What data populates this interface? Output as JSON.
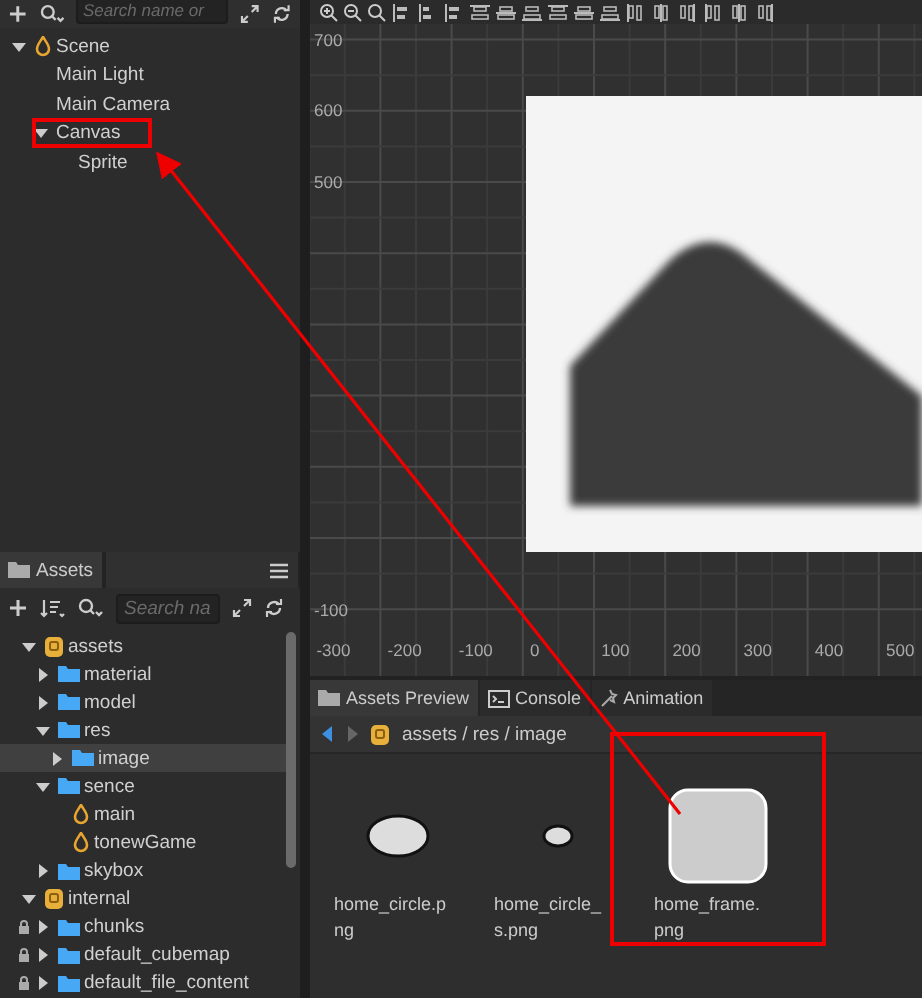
{
  "hierarchy": {
    "search": {
      "placeholder": "Search name or"
    },
    "tree": [
      {
        "label": "Scene",
        "kind": "scene",
        "expanded": true,
        "children": [
          {
            "label": "Main Light"
          },
          {
            "label": "Main Camera"
          },
          {
            "label": "Canvas",
            "expanded": true,
            "children": [
              {
                "label": "Sprite"
              }
            ]
          }
        ]
      }
    ]
  },
  "assets": {
    "tab": {
      "label": "Assets",
      "selected": true
    },
    "search": {
      "placeholder": "Search na"
    },
    "tree": [
      {
        "label": "assets",
        "kind": "db",
        "expanded": true,
        "children": [
          {
            "label": "material",
            "kind": "folder",
            "expanded": false
          },
          {
            "label": "model",
            "kind": "folder",
            "expanded": false
          },
          {
            "label": "res",
            "kind": "folder",
            "expanded": true,
            "children": [
              {
                "label": "image",
                "kind": "folder",
                "expanded": false,
                "selected": true
              }
            ]
          },
          {
            "label": "sence",
            "kind": "folder",
            "expanded": true,
            "children": [
              {
                "label": "main",
                "kind": "scene"
              },
              {
                "label": "tonewGame",
                "kind": "scene"
              }
            ]
          },
          {
            "label": "skybox",
            "kind": "folder",
            "expanded": false
          }
        ]
      },
      {
        "label": "internal",
        "kind": "db",
        "expanded": true,
        "children": [
          {
            "label": "chunks",
            "kind": "folder",
            "expanded": false,
            "locked": true
          },
          {
            "label": "default_cubemap",
            "kind": "folder",
            "expanded": false,
            "locked": true
          },
          {
            "label": "default_file_content",
            "kind": "folder",
            "expanded": false,
            "locked": true
          }
        ]
      }
    ]
  },
  "scene": {
    "y_labels": [
      "700",
      "600",
      "500",
      "-100"
    ],
    "x_labels": [
      "-300",
      "-200",
      "-100",
      "0",
      "100",
      "200",
      "300",
      "400",
      "500"
    ]
  },
  "bottom_panel": {
    "tabs": [
      {
        "label": "Assets Preview",
        "kind": "folder",
        "selected": true
      },
      {
        "label": "Console",
        "kind": "console",
        "selected": false
      },
      {
        "label": "Animation",
        "kind": "animation",
        "selected": false
      }
    ],
    "breadcrumb": "assets / res / image",
    "items": [
      {
        "name": "home_circle.png",
        "kind": "ellipse"
      },
      {
        "name": "home_circle_s.png",
        "kind": "dot"
      },
      {
        "name": "home_frame.png",
        "kind": "frame"
      }
    ]
  }
}
